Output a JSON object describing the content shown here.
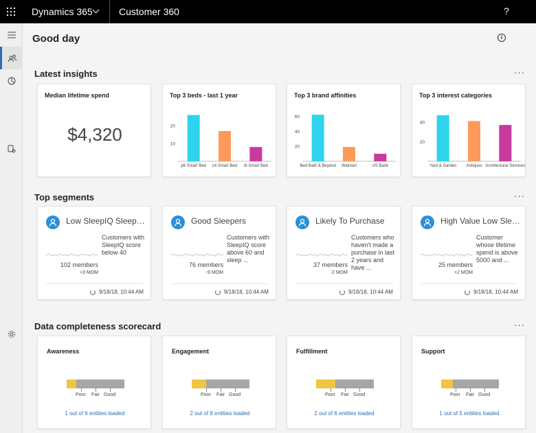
{
  "header": {
    "app_name": "Dynamics 365",
    "area_name": "Customer 360",
    "help": "?"
  },
  "page": {
    "title": "Good day"
  },
  "sections": {
    "insights": "Latest insights",
    "segments": "Top segments",
    "scorecard": "Data completeness scorecard",
    "more": "···"
  },
  "insights": {
    "median": {
      "title": "Median lifetime spend",
      "value": "$4,320"
    },
    "beds": {
      "title": "Top 3 beds - last 1 year"
    },
    "brands": {
      "title": "Top 3 brand affinities"
    },
    "interests": {
      "title": "Top 3 interest categories"
    }
  },
  "chart_data": [
    {
      "type": "bar",
      "title": "Top 3 beds - last 1 year",
      "categories": [
        "p6 Smart Bed",
        "c4 Smart Bed",
        "i6 Smart Bed"
      ],
      "values": [
        26,
        17,
        8
      ],
      "ylim": [
        0,
        27
      ],
      "yticks": [
        10,
        20
      ],
      "colors": [
        "#2dd4ec",
        "#fd9a5a",
        "#c83a9c"
      ]
    },
    {
      "type": "bar",
      "title": "Top 3 brand affinities",
      "categories": [
        "Bed Bath & Beyond",
        "Walmart",
        "US Bank"
      ],
      "values": [
        62,
        19,
        10
      ],
      "ylim": [
        0,
        64
      ],
      "yticks": [
        20,
        40,
        60
      ],
      "colors": [
        "#2dd4ec",
        "#fd9a5a",
        "#c83a9c"
      ]
    },
    {
      "type": "bar",
      "title": "Top 3 interest categories",
      "categories": [
        "Yard & Garden",
        "Antiques",
        "Architectural Services"
      ],
      "values": [
        47,
        41,
        37
      ],
      "ylim": [
        0,
        49
      ],
      "yticks": [
        20,
        40
      ],
      "colors": [
        "#2dd4ec",
        "#fd9a5a",
        "#c83a9c"
      ]
    }
  ],
  "segments": [
    {
      "name": "Low SleepIQ Sleepers",
      "description": "Customers with SleepIQ score below 40",
      "members": "102 members",
      "mom": "+3 MOM",
      "updated": "9/18/18, 10:44 AM"
    },
    {
      "name": "Good Sleepers",
      "description": "Customers with SleepIQ score above 60 and sleep ...",
      "members": "76 members",
      "mom": "-9 MOM",
      "updated": "9/18/18, 10:44 AM"
    },
    {
      "name": "Likely To Purchase",
      "description": "Customers who haven't made a purchase in last 2 years and have ...",
      "members": "37 members",
      "mom": "-2 MOM",
      "updated": "9/18/18, 10:44 AM"
    },
    {
      "name": "High Value Low Sleepers",
      "description": "Customer whose lifetime spend is above 5000 and ...",
      "members": "25 members",
      "mom": "+2 MOM",
      "updated": "9/18/18, 10:44 AM"
    }
  ],
  "scorecard": {
    "scale": {
      "poor": "Poor",
      "fair": "Fair",
      "good": "Good"
    },
    "items": [
      {
        "title": "Awareness",
        "loaded_fraction": 0.17,
        "link": "1 out of 6 entities loaded"
      },
      {
        "title": "Engagement",
        "loaded_fraction": 0.25,
        "link": "2 out of 8 entities loaded"
      },
      {
        "title": "Fulfillment",
        "loaded_fraction": 0.33,
        "link": "2 out of 6 entities loaded"
      },
      {
        "title": "Support",
        "loaded_fraction": 0.2,
        "link": "1 out of 5 entities loaded"
      }
    ]
  },
  "icons": {
    "waffle": "waffle-icon",
    "rail": [
      "hamburger-icon",
      "people-icon",
      "pie-chart-icon",
      "data-source-icon",
      "settings-icon"
    ]
  }
}
